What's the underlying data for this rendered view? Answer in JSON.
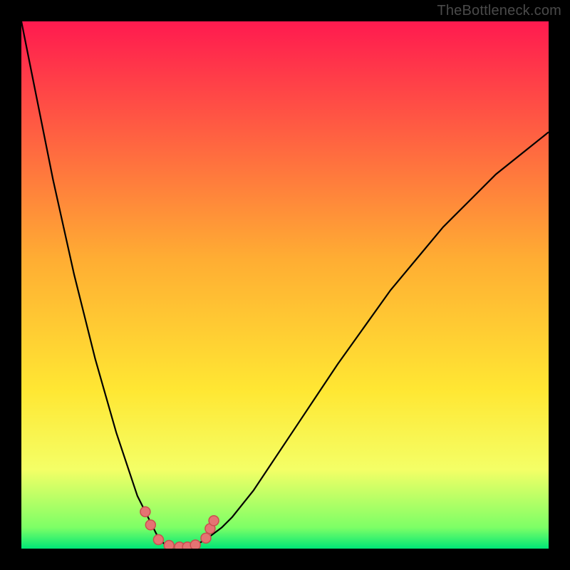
{
  "watermark": "TheBottleneck.com",
  "chart_data": {
    "type": "line",
    "title": "",
    "xlabel": "",
    "ylabel": "",
    "xlim": [
      0,
      100
    ],
    "ylim": [
      0,
      100
    ],
    "background_gradient": {
      "stops": [
        {
          "offset": 0.0,
          "color": "#ff1a4f"
        },
        {
          "offset": 0.45,
          "color": "#ffad33"
        },
        {
          "offset": 0.7,
          "color": "#ffe733"
        },
        {
          "offset": 0.85,
          "color": "#f4ff66"
        },
        {
          "offset": 0.96,
          "color": "#7dff66"
        },
        {
          "offset": 1.0,
          "color": "#00e676"
        }
      ]
    },
    "series": [
      {
        "name": "curve",
        "color": "#000000",
        "x": [
          0,
          2,
          4,
          6,
          8,
          10,
          12,
          14,
          16,
          18,
          20,
          21,
          22,
          23,
          24,
          25,
          26,
          27,
          28,
          29,
          30,
          31,
          32,
          33,
          34,
          36,
          38,
          40,
          42,
          44,
          48,
          52,
          56,
          60,
          65,
          70,
          75,
          80,
          85,
          90,
          95,
          100
        ],
        "y": [
          100,
          90,
          80,
          70,
          61,
          52,
          44,
          36,
          29,
          22,
          16,
          13,
          10,
          8,
          6,
          4,
          2,
          1,
          0.6,
          0.4,
          0.3,
          0.3,
          0.4,
          0.7,
          1.2,
          2.5,
          4.0,
          6.0,
          8.5,
          11,
          17,
          23,
          29,
          35,
          42,
          49,
          55,
          61,
          66,
          71,
          75,
          79
        ]
      }
    ],
    "markers": [
      {
        "x": 23.5,
        "y": 7.0
      },
      {
        "x": 24.5,
        "y": 4.5
      },
      {
        "x": 26.0,
        "y": 1.7
      },
      {
        "x": 28.0,
        "y": 0.6
      },
      {
        "x": 30.0,
        "y": 0.3
      },
      {
        "x": 31.5,
        "y": 0.3
      },
      {
        "x": 33.0,
        "y": 0.7
      },
      {
        "x": 35.0,
        "y": 2.0
      },
      {
        "x": 35.8,
        "y": 3.8
      },
      {
        "x": 36.5,
        "y": 5.3
      }
    ],
    "marker_style": {
      "radius": 7,
      "fill": "#e57373",
      "stroke": "#c94f4f",
      "stroke_width": 1.5
    }
  }
}
